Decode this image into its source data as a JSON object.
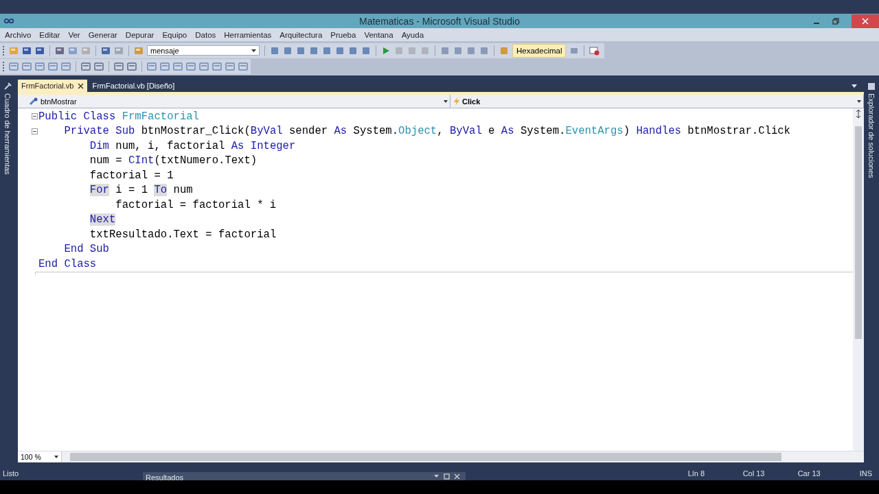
{
  "window": {
    "title": "Matematicas - Microsoft Visual Studio"
  },
  "menu": [
    "Archivo",
    "Editar",
    "Ver",
    "Generar",
    "Depurar",
    "Equipo",
    "Datos",
    "Herramientas",
    "Arquitectura",
    "Prueba",
    "Ventana",
    "Ayuda"
  ],
  "toolbar": {
    "combo_value": "mensaje",
    "hex_button": {
      "label": "Hexadecimal",
      "on": true
    }
  },
  "side_panels": {
    "left": "Cuadro de herramientas",
    "right": "Explorador de soluciones"
  },
  "tabs": [
    {
      "label": "FrmFactorial.vb",
      "selected": true,
      "closable": true
    },
    {
      "label": "FrmFactorial.vb [Diseño]",
      "selected": false,
      "closable": false
    }
  ],
  "editor": {
    "object_combo": "btnMostrar",
    "event_combo": "Click",
    "zoom": "100 %",
    "lines": [
      {
        "outline": true,
        "segments": [
          {
            "text": "Public Class ",
            "kind": "keyword",
            "highlighted": false
          },
          {
            "text": "FrmFactorial",
            "kind": "type",
            "highlighted": false
          }
        ],
        "children": [
          {
            "outline": true,
            "segments": [
              {
                "text": "Private Sub ",
                "kind": "keyword",
                "highlighted": false
              },
              {
                "text": "btnMostrar_Click(",
                "kind": "plain",
                "highlighted": false
              },
              {
                "text": "ByVal",
                "kind": "keyword",
                "highlighted": false
              },
              {
                "text": " sender ",
                "kind": "plain",
                "highlighted": false
              },
              {
                "text": "As",
                "kind": "keyword",
                "highlighted": false
              },
              {
                "text": " System.",
                "kind": "plain",
                "highlighted": false
              },
              {
                "text": "Object",
                "kind": "type",
                "highlighted": false
              },
              {
                "text": ", ",
                "kind": "plain",
                "highlighted": false
              },
              {
                "text": "ByVal",
                "kind": "keyword",
                "highlighted": false
              },
              {
                "text": " e ",
                "kind": "plain",
                "highlighted": false
              },
              {
                "text": "As",
                "kind": "keyword",
                "highlighted": false
              },
              {
                "text": " System.",
                "kind": "plain",
                "highlighted": false
              },
              {
                "text": "EventArgs",
                "kind": "type",
                "highlighted": false
              },
              {
                "text": ") ",
                "kind": "plain",
                "highlighted": false
              },
              {
                "text": "Handles",
                "kind": "keyword",
                "highlighted": false
              },
              {
                "text": " btnMostrar.Click",
                "kind": "plain",
                "highlighted": false
              }
            ],
            "children": [
              {
                "outline": false,
                "segments": [
                  {
                    "text": "Dim",
                    "kind": "keyword",
                    "highlighted": false
                  },
                  {
                    "text": " num, i, factorial ",
                    "kind": "plain",
                    "highlighted": false
                  },
                  {
                    "text": "As Integer",
                    "kind": "keyword",
                    "highlighted": false
                  }
                ]
              },
              {
                "outline": false,
                "segments": [
                  {
                    "text": "num = ",
                    "kind": "plain",
                    "highlighted": false
                  },
                  {
                    "text": "CInt",
                    "kind": "keyword",
                    "highlighted": false
                  },
                  {
                    "text": "(txtNumero.Text)",
                    "kind": "plain",
                    "highlighted": false
                  }
                ]
              },
              {
                "outline": false,
                "segments": [
                  {
                    "text": "factorial = 1",
                    "kind": "plain",
                    "highlighted": false
                  }
                ]
              },
              {
                "outline": false,
                "segments": [
                  {
                    "text": "For",
                    "kind": "keyword",
                    "highlighted": true
                  },
                  {
                    "text": " i = 1 ",
                    "kind": "plain",
                    "highlighted": false
                  },
                  {
                    "text": "To",
                    "kind": "keyword",
                    "highlighted": true
                  },
                  {
                    "text": " num",
                    "kind": "plain",
                    "highlighted": false
                  }
                ],
                "children": [
                  {
                    "outline": false,
                    "segments": [
                      {
                        "text": "factorial = factorial * i",
                        "kind": "plain",
                        "highlighted": false
                      }
                    ]
                  }
                ]
              },
              {
                "outline": false,
                "segments": [
                  {
                    "text": "Next",
                    "kind": "keyword",
                    "highlighted": true
                  }
                ]
              },
              {
                "outline": false,
                "segments": [
                  {
                    "text": "txtResultado.Text = factorial",
                    "kind": "plain",
                    "highlighted": false
                  }
                ]
              }
            ]
          },
          {
            "outline": false,
            "segments": [
              {
                "text": "End Sub",
                "kind": "keyword",
                "highlighted": false
              }
            ]
          }
        ]
      },
      {
        "outline": false,
        "segments": [
          {
            "text": "End Class",
            "kind": "keyword",
            "highlighted": false
          }
        ]
      }
    ]
  },
  "status_bar": {
    "message": "Listo",
    "line": "Lín 8",
    "column": "Col 13",
    "char": "Car 13",
    "mode": "INS"
  },
  "floating_panel": {
    "title": "Resultados"
  }
}
